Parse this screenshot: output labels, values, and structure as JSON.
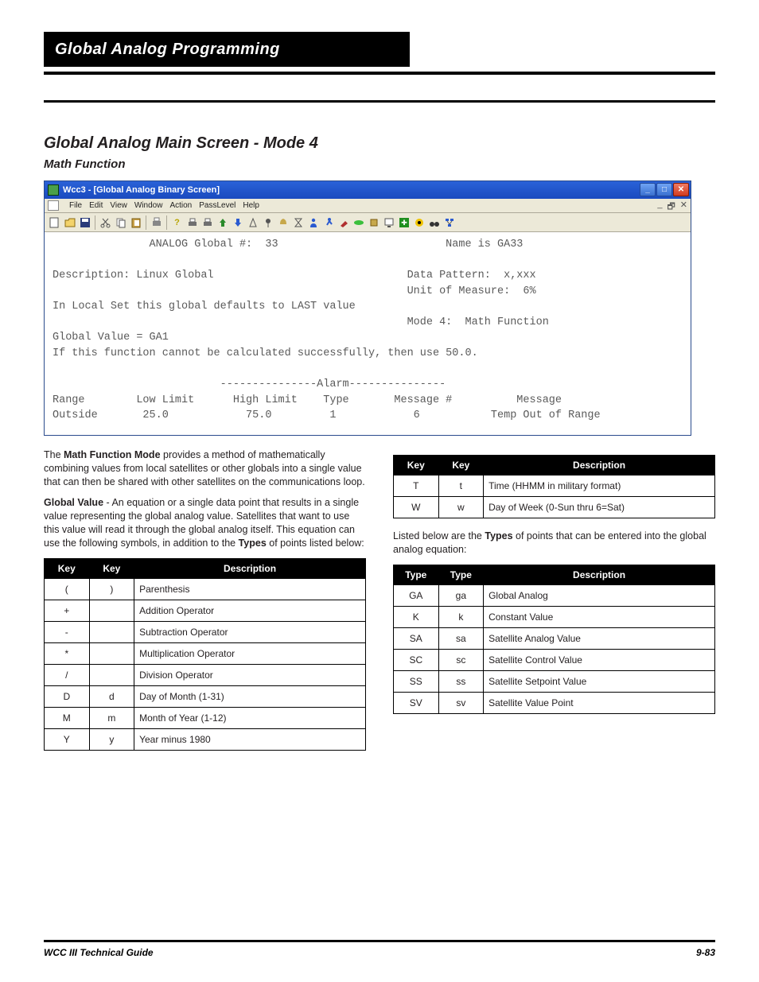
{
  "header": {
    "bar": "Global Analog Programming"
  },
  "section": {
    "title": "Global Analog Main Screen - Mode 4",
    "subtitle": "Math Function"
  },
  "window": {
    "title": "Wcc3 - [Global Analog Binary Screen]",
    "menus": [
      "File",
      "Edit",
      "View",
      "Window",
      "Action",
      "PassLevel",
      "Help"
    ]
  },
  "screen": {
    "line_analog": "               ANALOG Global #:  33                          Name is GA33",
    "line_blank1": "",
    "line_desc": "Description: Linux Global                              Data Pattern:  x,xxx",
    "line_uom": "                                                       Unit of Measure:  6%",
    "line_local": "In Local Set this global defaults to LAST value",
    "line_mode": "                                                       Mode 4:  Math Function",
    "line_gval": "Global Value = GA1",
    "line_fail": "If this function cannot be calculated successfully, then use 50.0.",
    "line_blank2": "",
    "line_alarmh": "                          ---------------Alarm---------------",
    "line_cols": "Range        Low Limit      High Limit    Type       Message #          Message",
    "line_vals": "Outside       25.0            75.0         1            6           Temp Out of Range"
  },
  "left": {
    "p1a": "The ",
    "p1b": "Math Function Mode",
    "p1c": " provides a method of mathematically combining values from local satellites or other globals into a single value that can then be shared with other satellites on the communications loop.",
    "p2a": "Global Value",
    "p2b": " - An equation or a single data point that results in a single value representing the global analog value. Satellites that want to use this value will read it through the global analog itself. This equation can use the following symbols, in addition to the ",
    "p2c": "Types",
    "p2d": " of points listed below:"
  },
  "left_table": {
    "headers": [
      "Key",
      "Key",
      "Description"
    ],
    "rows": [
      [
        "(",
        ")",
        "Parenthesis"
      ],
      [
        "+",
        "",
        "Addition Operator"
      ],
      [
        "-",
        "",
        "Subtraction Operator"
      ],
      [
        "*",
        "",
        "Multiplication Operator"
      ],
      [
        "/",
        "",
        "Division Operator"
      ],
      [
        "D",
        "d",
        "Day of Month (1-31)"
      ],
      [
        "M",
        "m",
        "Month of Year (1-12)"
      ],
      [
        "Y",
        "y",
        "Year minus 1980"
      ]
    ]
  },
  "right_small": {
    "headers": [
      "Key",
      "Key",
      "Description"
    ],
    "rows": [
      [
        "T",
        "t",
        "Time (HHMM in military format)"
      ],
      [
        "W",
        "w",
        "Day of Week (0-Sun thru 6=Sat)"
      ]
    ]
  },
  "right": {
    "p1a": "Listed below are the ",
    "p1b": "Types",
    "p1c": " of points that can be entered into the global analog equation:"
  },
  "right_table": {
    "headers": [
      "Type",
      "Type",
      "Description"
    ],
    "rows": [
      [
        "GA",
        "ga",
        "Global Analog"
      ],
      [
        "K",
        "k",
        "Constant Value"
      ],
      [
        "SA",
        "sa",
        "Satellite Analog Value"
      ],
      [
        "SC",
        "sc",
        "Satellite Control Value"
      ],
      [
        "SS",
        "ss",
        "Satellite Setpoint Value"
      ],
      [
        "SV",
        "sv",
        "Satellite Value Point"
      ]
    ]
  },
  "footer": {
    "left": "WCC III Technical Guide",
    "right": "9-83"
  }
}
